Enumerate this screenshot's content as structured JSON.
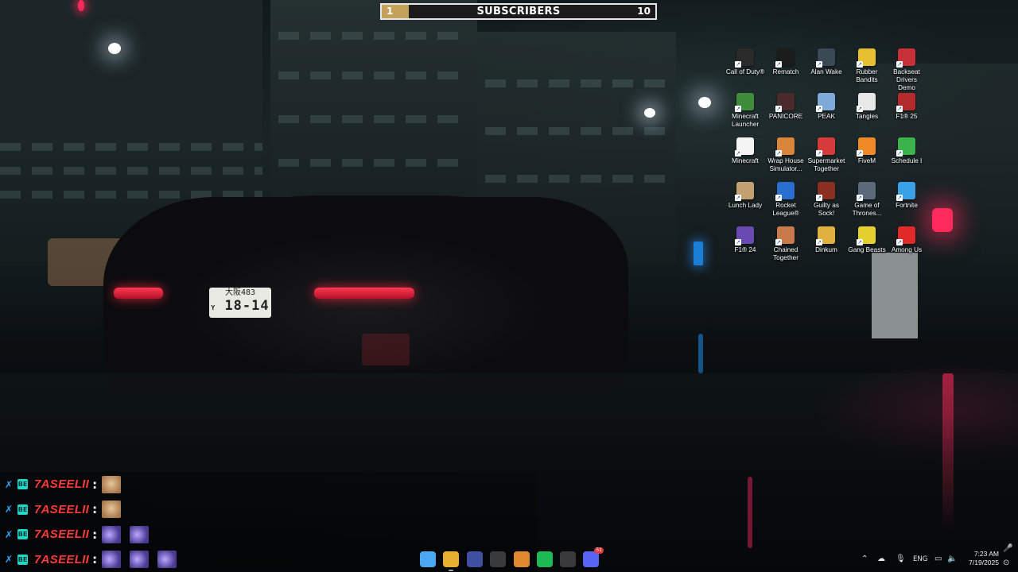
{
  "subscribers": {
    "current": "1",
    "label": "SUBSCRIBERS",
    "goal": "10",
    "progress_fraction": 0.1,
    "fill_color": "#c4a25a"
  },
  "desktop_icons": [
    {
      "name": "Call of Duty®",
      "icon": "call-of-duty-icon",
      "color": "#2a2a2a"
    },
    {
      "name": "Rematch",
      "icon": "rematch-icon",
      "color": "#1c1c1c"
    },
    {
      "name": "Alan Wake",
      "icon": "alan-wake-icon",
      "color": "#3a4a55"
    },
    {
      "name": "Rubber Bandits",
      "icon": "rubber-bandits-icon",
      "color": "#e6c030"
    },
    {
      "name": "Backseat Drivers Demo",
      "icon": "backseat-drivers-icon",
      "color": "#c8303a"
    },
    {
      "name": "Minecraft Launcher",
      "icon": "minecraft-launcher-icon",
      "color": "#3f8d3a"
    },
    {
      "name": "PANICORE",
      "icon": "panicore-icon",
      "color": "#4a2a2a"
    },
    {
      "name": "PEAK",
      "icon": "peak-icon",
      "color": "#7fa9d8"
    },
    {
      "name": "Tangles",
      "icon": "tangles-icon",
      "color": "#e8e8e8"
    },
    {
      "name": "F1® 25",
      "icon": "f1-25-icon",
      "color": "#b52b2b"
    },
    {
      "name": "Minecraft",
      "icon": "minecraft-file-icon",
      "color": "#f4f4f4"
    },
    {
      "name": "Wrap House Simulator...",
      "icon": "wrap-house-icon",
      "color": "#d9863a"
    },
    {
      "name": "Supermarket Together",
      "icon": "supermarket-together-icon",
      "color": "#d63a3a"
    },
    {
      "name": "FiveM",
      "icon": "fivem-icon",
      "color": "#f08a28"
    },
    {
      "name": "Schedule I",
      "icon": "schedule-i-icon",
      "color": "#3bb24a"
    },
    {
      "name": "Lunch Lady",
      "icon": "lunch-lady-icon",
      "color": "#c2a070"
    },
    {
      "name": "Rocket League®",
      "icon": "rocket-league-icon",
      "color": "#2a6fd0"
    },
    {
      "name": "Guilty as Sock!",
      "icon": "guilty-as-sock-icon",
      "color": "#8a3020"
    },
    {
      "name": "Game of Thrones...",
      "icon": "game-of-thrones-icon",
      "color": "#5a6a7a"
    },
    {
      "name": "Fortnite",
      "icon": "fortnite-icon",
      "color": "#3aa0e8"
    },
    {
      "name": "F1® 24",
      "icon": "f1-24-icon",
      "color": "#6a4ab0"
    },
    {
      "name": "Chained Together",
      "icon": "chained-together-icon",
      "color": "#c87a4a"
    },
    {
      "name": "Dinkum",
      "icon": "dinkum-icon",
      "color": "#e0b040"
    },
    {
      "name": "Gang Beasts",
      "icon": "gang-beasts-icon",
      "color": "#e6d030"
    },
    {
      "name": "Among Us",
      "icon": "among-us-icon",
      "color": "#e02a2a"
    }
  ],
  "chat": [
    {
      "user": "7ASEELII",
      "emotes": [
        "face"
      ]
    },
    {
      "user": "7ASEELII",
      "emotes": [
        "face"
      ]
    },
    {
      "user": "7ASEELII",
      "emotes": [
        "purple",
        "purple"
      ]
    },
    {
      "user": "7ASEELII",
      "emotes": [
        "purple",
        "purple",
        "purple"
      ]
    }
  ],
  "taskbar": {
    "apps": [
      {
        "icon": "windows-start-icon",
        "color": "#4aa8f0"
      },
      {
        "icon": "chrome-icon",
        "color": "#e8b030"
      },
      {
        "icon": "psp-icon",
        "color": "#4050a0"
      },
      {
        "icon": "obs-icon",
        "color": "#3a3a3a"
      },
      {
        "icon": "flstudio-icon",
        "color": "#e08a30"
      },
      {
        "icon": "spotify-icon",
        "color": "#1db954"
      },
      {
        "icon": "xbox-icon",
        "color": "#3a3a3a"
      },
      {
        "icon": "discord-icon",
        "color": "#5865f2"
      }
    ],
    "discord_badge": "51",
    "language": "ENG",
    "time": "7:23 AM",
    "date": "7/19/2025"
  },
  "plate": {
    "line1": "大阪483",
    "line2": "18-14",
    "prefix": "Y"
  }
}
